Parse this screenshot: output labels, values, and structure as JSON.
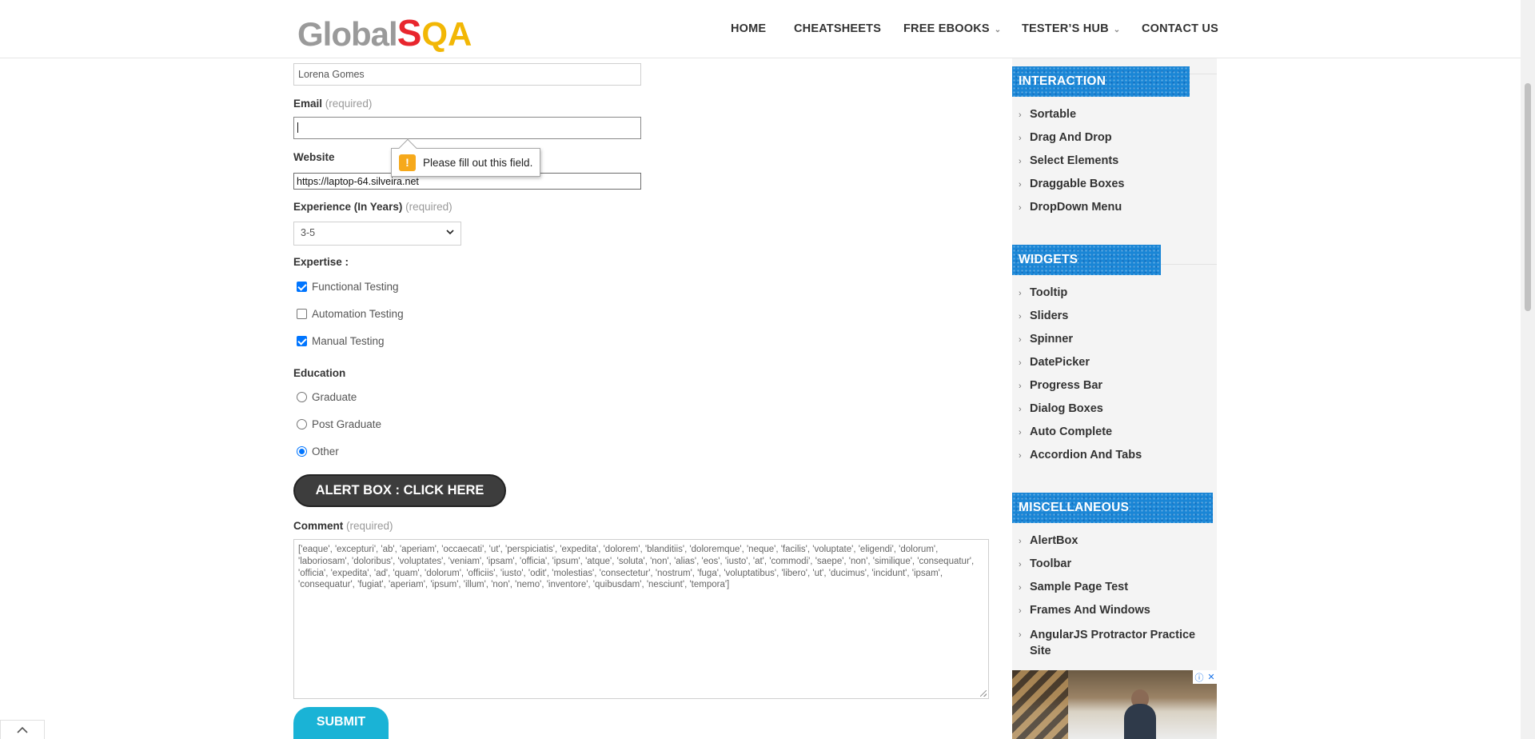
{
  "header": {
    "logo": {
      "part1": "Global",
      "part2": "S",
      "part3": "QA"
    },
    "nav": [
      {
        "label": "HOME",
        "has_caret": false
      },
      {
        "label": "CHEATSHEETS",
        "has_caret": false
      },
      {
        "label": "FREE EBOOKS",
        "has_caret": true
      },
      {
        "label": "TESTER’S HUB",
        "has_caret": true
      },
      {
        "label": "CONTACT US",
        "has_caret": false
      }
    ],
    "caret_glyph": "⌄"
  },
  "form": {
    "name_value": "Lorena Gomes",
    "email_label": "Email",
    "email_required": "(required)",
    "email_value": "",
    "website_label": "Website",
    "website_value": "https://laptop-64.silveira.net",
    "experience_label": "Experience (In Years)",
    "experience_required": "(required)",
    "experience_selected": "3-5",
    "expertise_label": "Expertise :",
    "expertise_options": [
      {
        "label": "Functional Testing",
        "checked": true
      },
      {
        "label": "Automation Testing",
        "checked": false
      },
      {
        "label": "Manual Testing",
        "checked": true
      }
    ],
    "education_label": "Education",
    "education_options": [
      {
        "label": "Graduate",
        "selected": false
      },
      {
        "label": "Post Graduate",
        "selected": false
      },
      {
        "label": "Other",
        "selected": true
      }
    ],
    "alert_button_label": "ALERT BOX : CLICK HERE",
    "comment_label": "Comment",
    "comment_required": "(required)",
    "comment_value": "['eaque', 'excepturi', 'ab', 'aperiam', 'occaecati', 'ut', 'perspiciatis', 'expedita', 'dolorem', 'blanditiis', 'doloremque', 'neque', 'facilis', 'voluptate', 'eligendi', 'dolorum', 'laboriosam', 'doloribus', 'voluptates', 'veniam', 'ipsam', 'officia', 'ipsum', 'atque', 'soluta', 'non', 'alias', 'eos', 'iusto', 'at', 'commodi', 'saepe', 'non', 'similique', 'consequatur', 'officia', 'expedita', 'ad', 'quam', 'dolorum', 'officiis', 'iusto', 'odit', 'molestias', 'consectetur', 'nostrum', 'fuga', 'voluptatibus', 'libero', 'ut', 'ducimus', 'incidunt', 'ipsam', 'consequatur', 'fugiat', 'aperiam', 'ipsum', 'illum', 'non', 'nemo', 'inventore', 'quibusdam', 'nesciunt', 'tempora']",
    "submit_label": "SUBMIT"
  },
  "validation_tooltip": {
    "icon": "!",
    "message": "Please fill out this field."
  },
  "sidebar": {
    "sections": [
      {
        "title": "INTERACTION",
        "items": [
          "Sortable",
          "Drag And Drop",
          "Select Elements",
          "Draggable Boxes",
          "DropDown Menu"
        ]
      },
      {
        "title": "WIDGETS",
        "items": [
          "Tooltip",
          "Sliders",
          "Spinner",
          "DatePicker",
          "Progress Bar",
          "Dialog Boxes",
          "Auto Complete",
          "Accordion And Tabs"
        ]
      },
      {
        "title": "MISCELLANEOUS",
        "items": [
          "AlertBox",
          "Toolbar",
          "Sample Page Test",
          "Frames And Windows",
          "AngularJS Protractor Practice Site"
        ]
      }
    ],
    "chevron_glyph": "›"
  },
  "ad": {
    "info_icon": "ⓘ",
    "close_icon": "✕"
  },
  "misc": {
    "collapse_glyph": "︿"
  },
  "colors": {
    "accent": "#1a86d6",
    "submit": "#1ab3d6",
    "alert_button": "#3d3d3d",
    "checkbox": "#0075ff",
    "warning": "#f6a91b"
  }
}
